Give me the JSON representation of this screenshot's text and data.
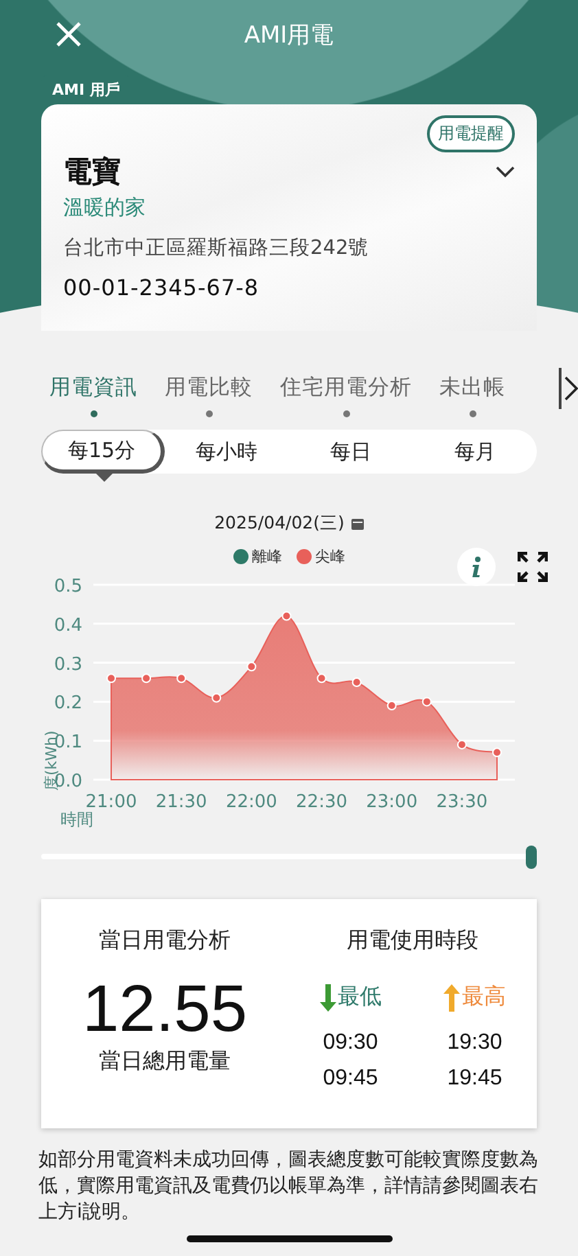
{
  "header": {
    "title": "AMI用電"
  },
  "account": {
    "badge": "AMI 用戶",
    "reminder_button": "用電提醒",
    "name": "電寶",
    "nickname": "溫暖的家",
    "address": "台北市中正區羅斯福路三段242號",
    "account_number": "00-01-2345-67-8"
  },
  "tabs": [
    {
      "label": "用電資訊",
      "selected": true
    },
    {
      "label": "用電比較",
      "selected": false
    },
    {
      "label": "住宅用電分析",
      "selected": false
    },
    {
      "label": "未出帳",
      "selected": false
    }
  ],
  "periods": [
    {
      "label": "每15分",
      "selected": true
    },
    {
      "label": "每小時",
      "selected": false
    },
    {
      "label": "每日",
      "selected": false
    },
    {
      "label": "每月",
      "selected": false
    }
  ],
  "chart": {
    "date": "2025/04/02(三)",
    "chart_data": {
      "type": "area",
      "xlabel": "時間",
      "ylabel": "度(kWh)",
      "categories": [
        "21:00",
        null,
        "21:30",
        null,
        "22:00",
        null,
        "22:30",
        null,
        "23:00",
        null,
        "23:30",
        null
      ],
      "series": [
        {
          "name": "離峰",
          "color": "#2e7a68",
          "values": [
            null,
            null,
            null,
            null,
            null,
            null,
            null,
            null,
            null,
            null,
            null,
            null
          ]
        },
        {
          "name": "尖峰",
          "color": "#e8605a",
          "values": [
            0.26,
            0.26,
            0.26,
            0.21,
            0.29,
            0.42,
            0.26,
            0.25,
            0.19,
            0.2,
            0.09,
            0.07
          ]
        }
      ],
      "ylim": [
        0,
        0.5
      ],
      "yticks": [
        {
          "value": 0,
          "label": "0.0"
        },
        0.1,
        0.2,
        0.3,
        0.4,
        0.5
      ],
      "grid": true
    }
  },
  "range_slider": {
    "level": 1
  },
  "summary": {
    "title": "當日用電分析",
    "total": "12.55",
    "total_label": "當日總用電量",
    "period_title": "用電使用時段",
    "columns": [
      {
        "kind": "lowest",
        "label": "最低",
        "times": [
          "09:30",
          "09:45"
        ]
      },
      {
        "kind": "highest",
        "label": "最高",
        "times": [
          "19:30",
          "19:45"
        ]
      }
    ]
  },
  "note": "如部分用電資料未成功回傳，圖表總度數可能較實際度數為低，實際用電資訊及電費仍以帳單為準，詳情請參閱圖表右上方i說明。"
}
